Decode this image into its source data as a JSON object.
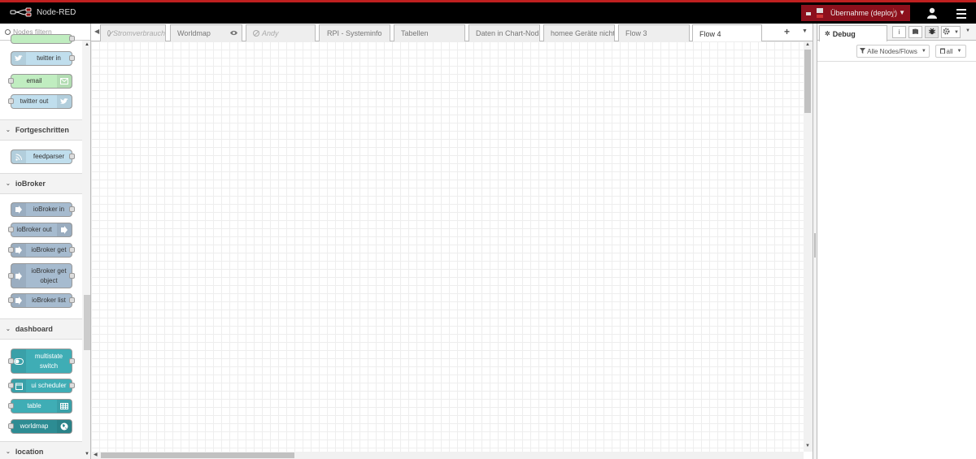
{
  "header": {
    "app_title": "Node-RED",
    "deploy_label": "Übernahme (deploy)"
  },
  "palette": {
    "search_placeholder": "Nodes filtern",
    "top_nodes": [
      "twitter in",
      "email",
      "twitter out"
    ],
    "sections": [
      {
        "title": "Fortgeschritten",
        "nodes": [
          "feedparser"
        ]
      },
      {
        "title": "ioBroker",
        "nodes": [
          "ioBroker in",
          "ioBroker out",
          "ioBroker get",
          "ioBroker get object",
          "ioBroker list"
        ]
      },
      {
        "title": "dashboard",
        "nodes": [
          "multistate switch",
          "ui scheduler",
          "table",
          "worldmap"
        ]
      },
      {
        "title": "location",
        "nodes": []
      }
    ]
  },
  "workspace": {
    "tabs": [
      {
        "label": "Stromverbrauch",
        "disabled": true
      },
      {
        "label": "Worldmap",
        "hidden": true
      },
      {
        "label": "Andy",
        "disabled": true
      },
      {
        "label": "RPI - Systeminfo"
      },
      {
        "label": "Tabellen"
      },
      {
        "label": "Daten in Chart-Node"
      },
      {
        "label": "homee Geräte nicht"
      },
      {
        "label": "Flow 3"
      },
      {
        "label": "Flow 4",
        "active": true
      }
    ],
    "add_tab_label": "+"
  },
  "sidebar": {
    "active_tab": "Debug",
    "filter_label": "Alle Nodes/Flows",
    "clear_label": "all",
    "buttons": [
      "i",
      "book-icon",
      "bug-icon",
      "gear-icon"
    ]
  },
  "colors": {
    "header_bg": "#000000",
    "deploy_bg": "#8c101c",
    "dashboard_node": "#3fadb5",
    "iobroker_node": "#a6bbcf",
    "social_node": "#c0deed",
    "email_node": "#c0edc0"
  }
}
